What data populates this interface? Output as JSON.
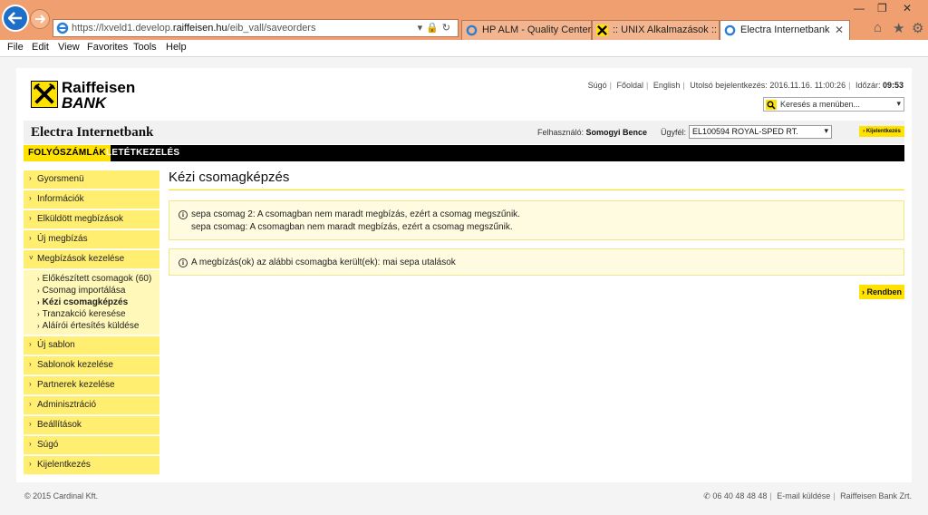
{
  "browser": {
    "url_prefix": "https://lxveld1.develop.",
    "url_domain": "raiffeisen.hu",
    "url_path": "/eib_vall/saveorders",
    "tabs": [
      {
        "label": "HP ALM - Quality Center 1..."
      },
      {
        "label": ":: UNIX Alkalmazások ::"
      },
      {
        "label": "Electra Internetbank"
      }
    ],
    "menu": [
      "File",
      "Edit",
      "View",
      "Favorites",
      "Tools",
      "Help"
    ]
  },
  "header": {
    "logo_line1": "Raiffeisen",
    "logo_line2": "BANK",
    "links": [
      "Súgó",
      "Főoldal",
      "English"
    ],
    "last_login_label": "Utolsó bejelentkezés:",
    "last_login_value": "2016.11.16. 11:00:26",
    "time_label": "Időzár:",
    "time_value": "09:53",
    "search_placeholder": "Keresés a menüben..."
  },
  "appbar": {
    "title": "Electra Internetbank",
    "user_label": "Felhasználó:",
    "user_name": "Somogyi Bence",
    "client_label": "Ügyfél:",
    "client_value": "EL100594 ROYAL-SPED RT.",
    "logout": "Kijelentkezés"
  },
  "mainnav": {
    "tabs": [
      "FOLYÓSZÁMLÁK",
      "LETÉTKEZELÉS"
    ]
  },
  "sidebar": {
    "items_top": [
      "Gyorsmenü",
      "Információk",
      "Elküldött megbízások",
      "Új megbízás",
      "Megbízások kezelése"
    ],
    "sub_items": [
      "Előkészített csomagok (60)",
      "Csomag importálása",
      "Kézi csomagképzés",
      "Tranzakció keresése",
      "Aláírói értesítés küldése"
    ],
    "items_bottom": [
      "Új sablon",
      "Sablonok kezelése",
      "Partnerek kezelése",
      "Adminisztráció",
      "Beállítások",
      "Súgó",
      "Kijelentkezés"
    ]
  },
  "content": {
    "title": "Kézi csomagképzés",
    "message1_line1": "sepa csomag 2: A csomagban nem maradt megbízás, ezért a csomag megszűnik.",
    "message1_line2": "sepa csomag: A csomagban nem maradt megbízás, ezért a csomag megszűnik.",
    "message2": "A megbízás(ok) az alábbi csomagba került(ek): mai sepa utalások",
    "ok_button": "Rendben"
  },
  "footer": {
    "copyright": "© 2015 Cardinal Kft.",
    "phone": "06 40 48 48 48",
    "email": "E-mail küldése",
    "company": "Raiffeisen Bank Zrt."
  },
  "colors": {
    "accent_yellow": "#ffe200",
    "sidebar_yellow": "#ffee70",
    "chrome_orange": "#f0a070"
  }
}
